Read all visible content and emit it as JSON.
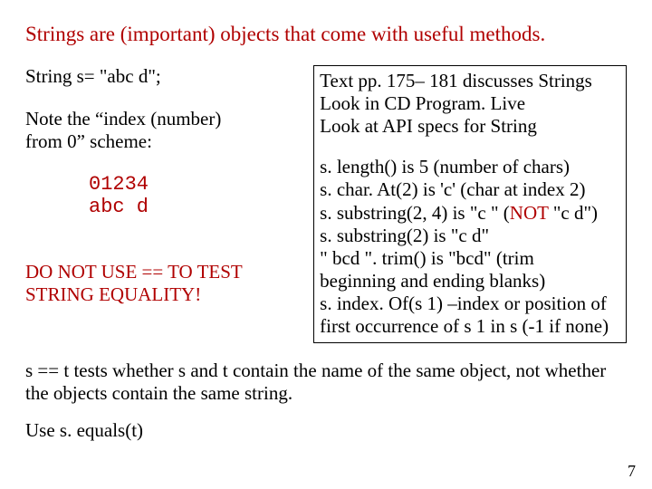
{
  "title": "Strings are (important) objects that come with useful methods.",
  "left": {
    "decl": "String s= \"abc d\";",
    "note_scheme_1": "Note the “index (number)",
    "note_scheme_2": "from 0” scheme:",
    "idx_digits": "01234",
    "idx_chars": "abc d",
    "warn1": "DO NOT USE == TO TEST",
    "warn2": "STRING EQUALITY!"
  },
  "right": {
    "l1": "Text pp. 175– 181 discusses Strings",
    "l2": "Look in CD Program. Live",
    "l3": "Look at API specs for String",
    "m1": "s. length()  is 5   (number of chars)",
    "m2": "s. char. At(2)   is 'c'  (char at index 2)",
    "m3a": "s. substring(2, 4)  is  \"c \"  (",
    "m3b": "NOT",
    "m3c": " \"c d\")",
    "m4": "s. substring(2)    is  \"c d\"",
    "m5": "\"  bcd   \". trim()  is \"bcd\" (trim",
    "m6": "beginning and ending blanks)",
    "m7": "s. index. Of(s 1) –index or position of",
    "m8": "first occurrence of s 1 in s (-1 if none)"
  },
  "after": {
    "eq": "s == t tests whether s and t contain the name of the same object, not whether the objects contain the same string.",
    "use": "Use s. equals(t)"
  },
  "page": "7"
}
